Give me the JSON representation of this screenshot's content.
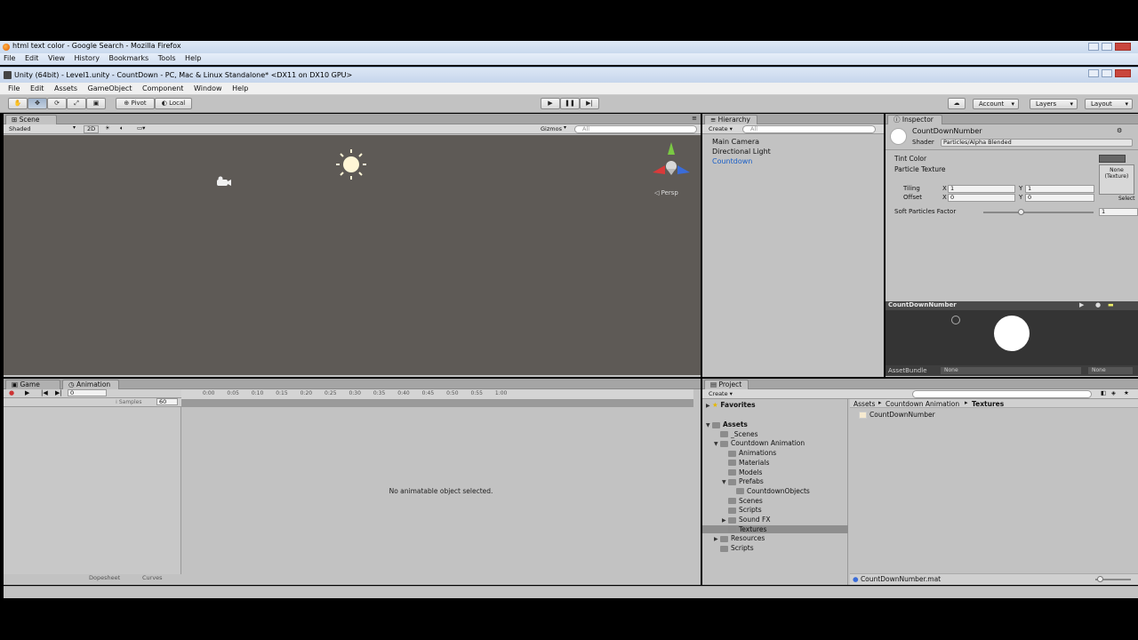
{
  "firefox": {
    "title": "html text color - Google Search - Mozilla Firefox",
    "menu": [
      "File",
      "Edit",
      "View",
      "History",
      "Bookmarks",
      "Tools",
      "Help"
    ]
  },
  "unity": {
    "title": "Unity (64bit) - Level1.unity - CountDown - PC, Mac & Linux Standalone* <DX11 on DX10 GPU>",
    "menu": [
      "File",
      "Edit",
      "Assets",
      "GameObject",
      "Component",
      "Window",
      "Help"
    ],
    "toolbar": {
      "pivot": "Pivot",
      "local": "Local",
      "account": "Account",
      "layers": "Layers",
      "layout": "Layout"
    },
    "scene": {
      "tab": "Scene",
      "shading": "Shaded",
      "mode2d": "2D",
      "gizmos": "Gizmos",
      "search_placeholder": "All",
      "persp": "Persp"
    },
    "hierarchy": {
      "tab": "Hierarchy",
      "create": "Create",
      "search_placeholder": "All",
      "items": [
        "Main Camera",
        "Directional Light",
        "Countdown"
      ]
    },
    "inspector": {
      "tab": "Inspector",
      "object_name": "CountDownNumber",
      "shader_label": "Shader",
      "shader_value": "Particles/Alpha Blended",
      "tint_color": "Tint Color",
      "particle_texture": "Particle Texture",
      "texture_none": "None\n(Texture)",
      "select": "Select",
      "tiling": "Tiling",
      "offset": "Offset",
      "tiling_x": "1",
      "tiling_y": "1",
      "offset_x": "0",
      "offset_y": "0",
      "soft_particles": "Soft Particles Factor",
      "soft_value": "1",
      "preview_title": "CountDownNumber",
      "assetbundle": "AssetBundle",
      "assetbundle_value": "None",
      "assetbundle_variant": "None"
    },
    "animation": {
      "game_tab": "Game",
      "anim_tab": "Animation",
      "samples_label": "Samples",
      "samples_value": "60",
      "frame": "0",
      "ticks": [
        "0:00",
        "0:05",
        "0:10",
        "0:15",
        "0:20",
        "0:25",
        "0:30",
        "0:35",
        "0:40",
        "0:45",
        "0:50",
        "0:55",
        "1:00"
      ],
      "empty_msg": "No animatable object selected.",
      "dopesheet": "Dopesheet",
      "curves": "Curves"
    },
    "project": {
      "tab": "Project",
      "create": "Create",
      "favorites": "Favorites",
      "tree": [
        {
          "label": "Assets",
          "level": 0
        },
        {
          "label": "_Scenes",
          "level": 1
        },
        {
          "label": "Countdown Animation",
          "level": 1
        },
        {
          "label": "Animations",
          "level": 2
        },
        {
          "label": "Materials",
          "level": 2
        },
        {
          "label": "Models",
          "level": 2
        },
        {
          "label": "Prefabs",
          "level": 2
        },
        {
          "label": "CountdownObjects",
          "level": 3
        },
        {
          "label": "Scenes",
          "level": 2
        },
        {
          "label": "Scripts",
          "level": 2
        },
        {
          "label": "Sound FX",
          "level": 2
        },
        {
          "label": "Textures",
          "level": 2
        },
        {
          "label": "Resources",
          "level": 1
        },
        {
          "label": "Scripts",
          "level": 1
        }
      ],
      "breadcrumb": [
        "Assets",
        "Countdown Animation",
        "Textures"
      ],
      "files": [
        "CountDownNumber"
      ],
      "selected_path": "CountDownNumber.mat"
    }
  }
}
